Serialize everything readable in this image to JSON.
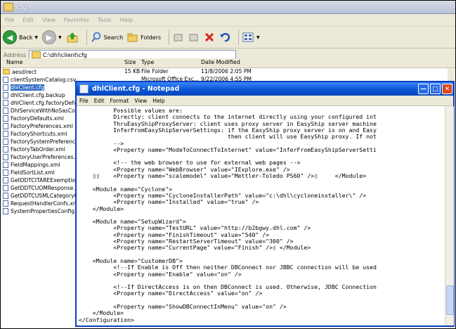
{
  "explorer": {
    "title": "cfg",
    "menu": [
      "File",
      "Edit",
      "View",
      "Favorites",
      "Tools",
      "Help"
    ],
    "toolbar": {
      "back": "Back",
      "search": "Search",
      "folders": "Folders"
    },
    "address_label": "Address",
    "address_value": "C:\\dhl\\client\\cfg",
    "columns": {
      "name": "Name",
      "size": "Size",
      "type": "Type",
      "date": "Date Modified"
    },
    "files": [
      {
        "name": "aesdirect",
        "size": "",
        "type": "File Folder",
        "date": "11/8/2006 2:05 PM",
        "kind": "folder"
      },
      {
        "name": "clientSystemCatalog.csv",
        "size": "15 KB",
        "type": "Microsoft Office Exc...",
        "date": "9/22/2006 4:55 PM",
        "kind": "file"
      },
      {
        "name": "dhlClient.cfg",
        "size": "",
        "type": "",
        "date": "",
        "kind": "file",
        "selected": true
      },
      {
        "name": "dhlClient.cfg.backup",
        "size": "",
        "type": "",
        "date": "",
        "kind": "file"
      },
      {
        "name": "dhlClient.cfg.factoryDefaul",
        "size": "",
        "type": "",
        "date": "",
        "kind": "file"
      },
      {
        "name": "DhlServiceWithNoSasCodeM",
        "size": "",
        "type": "",
        "date": "",
        "kind": "file"
      },
      {
        "name": "FactoryDefaults.xml",
        "size": "",
        "type": "",
        "date": "",
        "kind": "file"
      },
      {
        "name": "FactoryPreferences.xml",
        "size": "",
        "type": "",
        "date": "",
        "kind": "file"
      },
      {
        "name": "FactoryShortcuts.xml",
        "size": "",
        "type": "",
        "date": "",
        "kind": "file"
      },
      {
        "name": "FactorySystemPreferences",
        "size": "",
        "type": "",
        "date": "",
        "kind": "file"
      },
      {
        "name": "FactoryTabOrder.xml",
        "size": "",
        "type": "",
        "date": "",
        "kind": "file"
      },
      {
        "name": "FactoryUserPreferences.xm",
        "size": "",
        "type": "",
        "date": "",
        "kind": "file"
      },
      {
        "name": "FieldMappings.xml",
        "size": "",
        "type": "",
        "date": "",
        "kind": "file"
      },
      {
        "name": "FieldSortList.xml",
        "size": "",
        "type": "",
        "date": "",
        "kind": "file"
      },
      {
        "name": "GetDDTCITAREExemptionRe",
        "size": "",
        "type": "",
        "date": "",
        "kind": "file"
      },
      {
        "name": "GetDDTCUOMResponse.xm",
        "size": "",
        "type": "",
        "date": "",
        "kind": "file"
      },
      {
        "name": "GetDDTCUSMLCategoryCod",
        "size": "",
        "type": "",
        "date": "",
        "kind": "file"
      },
      {
        "name": "RequestHandlerConfs.xml",
        "size": "",
        "type": "",
        "date": "",
        "kind": "file"
      },
      {
        "name": "SystemPropertiesConfig.xm",
        "size": "",
        "type": "",
        "date": "",
        "kind": "file"
      }
    ]
  },
  "notepad": {
    "title": "dhlClient.cfg - Notepad",
    "menu": [
      "File",
      "Edit",
      "Format",
      "View",
      "Help"
    ],
    "lines": [
      "          Possible values are:",
      "          Directly: client connects to the internet directly using your configured int",
      "          ThruEasyShipProxyServer: client uses proxy server in EasyShip server machine",
      "          InferFromEasyShipServerSettings: if the EasyShip proxy server is on and Easy",
      "                                           then client will use EasyShip proxy. If not",
      "          -->",
      "          <Property name=\"ModeToConnectToInternet\" value=\"InferFromEasyShipServerSetti",
      "",
      "          <!-- the web browser to use for external web pages -->",
      "          <Property name=\"WebBrowser\" value=\"IExplore.exe\" />",
      "    ▯▯    <Property name=\"scalemodel\" value=\"Mettler-Toledo PS60\" />▯     </Module>",
      "",
      "    <Module name=\"Cyclone\">",
      "          <Property name=\"CycloneInstallerPath\" value=\"c:\\dhl\\cycloneinstaller\\\" />",
      "          <Property name=\"Installed\" value=\"true\" />",
      "    </Module>",
      "",
      "    <Module name=\"SetupWizard\">",
      "          <Property name=\"TestURL\" value=\"http://b2bgwy.dhl.com\" />",
      "          <Property name=\"FinishTimeout\" value=\"540\" />",
      "          <Property name=\"RestartServerTimeout\" value=\"300\" />",
      "          <Property name=\"CurrentPage\" value=\"Finish\" />▯ </Module>",
      "",
      "    <Module name=\"CustomerDB\">",
      "          <!--If Enable is Off then neither DBConnect nor JBBC connection will be used",
      "          <Property name=\"Enable\" value=\"on\" />",
      "",
      "          <!--If DirectAccess is on then DBConnect is used. Otherwise, JDBC Connection",
      "          <Property name=\"DirectAccess\" value=\"on\" />",
      "",
      "          <Property name=\"ShowDBConnectInMenu\" value=\"on\" />",
      "    </Module>",
      "</Configuration>"
    ]
  }
}
